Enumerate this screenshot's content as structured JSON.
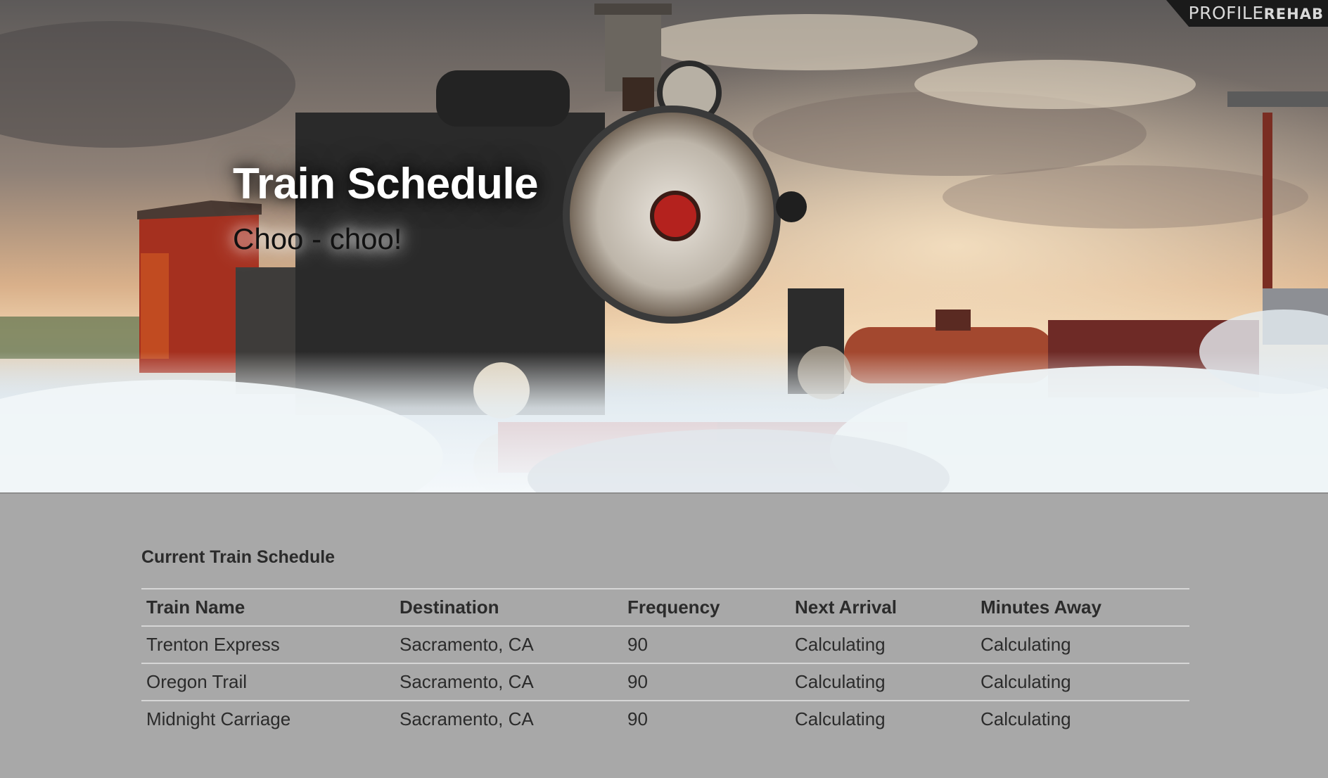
{
  "hero": {
    "title": "Train Schedule",
    "subtitle": "Choo - choo!",
    "watermark": "PROFILE",
    "watermark_small": "REHAB"
  },
  "schedule": {
    "heading": "Current Train Schedule",
    "columns": [
      "Train Name",
      "Destination",
      "Frequency",
      "Next Arrival",
      "Minutes Away"
    ],
    "rows": [
      [
        "Trenton Express",
        "Sacramento, CA",
        "90",
        "Calculating",
        "Calculating"
      ],
      [
        "Oregon Trail",
        "Sacramento, CA",
        "90",
        "Calculating",
        "Calculating"
      ],
      [
        "Midnight Carriage",
        "Sacramento, CA",
        "90",
        "Calculating",
        "Calculating"
      ]
    ]
  },
  "colors": {
    "page_background": "#a8a8a8",
    "table_text": "#2b2b2b",
    "table_rule": "#d6d6d6"
  }
}
